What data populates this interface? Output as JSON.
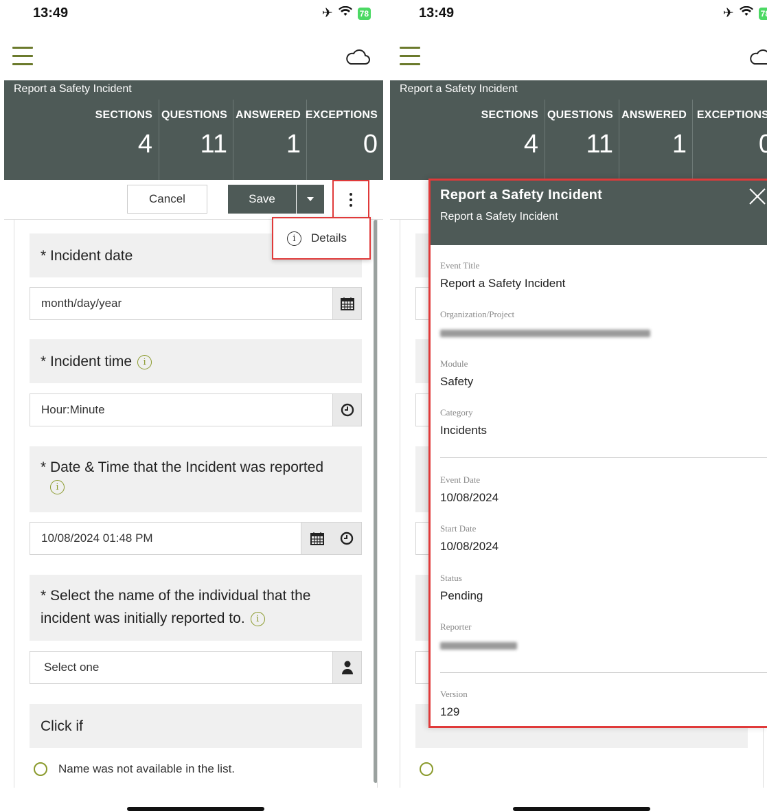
{
  "status": {
    "time": "13:49",
    "battery": "78"
  },
  "form": {
    "title": "Report a Safety Incident",
    "stats": [
      {
        "label": "SECTIONS",
        "value": "4"
      },
      {
        "label": "QUESTIONS",
        "value": "11"
      },
      {
        "label": "ANSWERED",
        "value": "1"
      },
      {
        "label": "EXCEPTIONS",
        "value": "0"
      }
    ],
    "toolbar": {
      "cancel_label": "Cancel",
      "save_label": "Save"
    },
    "menu": {
      "details_label": "Details"
    },
    "questions": {
      "q1": "* Incident date",
      "q1_placeholder": "month/day/year",
      "q2": "* Incident time",
      "q2_placeholder": "Hour:Minute",
      "q3": "* Date & Time that the Incident was reported",
      "q3_value": "10/08/2024 01:48 PM",
      "q4_line1": "* Select the name of the individual that the",
      "q4_line2": "incident was initially reported to.",
      "q4_select": "Select one",
      "q5": "Click if",
      "q5_option": "Name was not available in the list."
    }
  },
  "details": {
    "title": "Report a Safety Incident",
    "subtitle": "Report a Safety Incident",
    "fields": {
      "event_title_label": "Event Title",
      "event_title_value": "Report a Safety Incident",
      "org_label": "Organization/Project",
      "module_label": "Module",
      "module_value": "Safety",
      "category_label": "Category",
      "category_value": "Incidents",
      "event_date_label": "Event Date",
      "event_date_value": "10/08/2024",
      "start_date_label": "Start Date",
      "start_date_value": "10/08/2024",
      "status_label": "Status",
      "status_value": "Pending",
      "reporter_label": "Reporter",
      "version_label": "Version",
      "version_value": "129"
    }
  },
  "colors": {
    "header": "#4e5a57",
    "accent": "#6b7a2c",
    "highlight": "#e03a3a"
  },
  "icons": [
    "hamburger-icon",
    "cloud-icon",
    "airplane-icon",
    "wifi-icon",
    "calendar-icon",
    "clock-icon",
    "info-icon",
    "person-icon",
    "close-icon",
    "more-vertical-icon"
  ]
}
